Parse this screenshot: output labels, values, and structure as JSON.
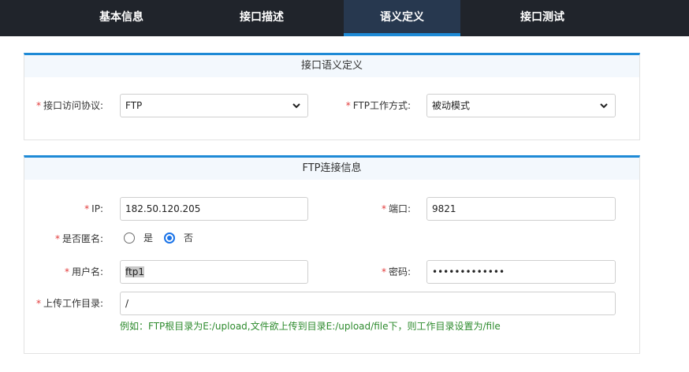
{
  "tabs": [
    {
      "label": "基本信息",
      "active": false
    },
    {
      "label": "接口描述",
      "active": false
    },
    {
      "label": "语义定义",
      "active": true
    },
    {
      "label": "接口测试",
      "active": false
    }
  ],
  "semantic_panel": {
    "title": "接口语义定义",
    "protocol": {
      "label": "接口访问协议:",
      "value": "FTP"
    },
    "ftp_mode": {
      "label": "FTP工作方式:",
      "value": "被动模式"
    }
  },
  "ftp_panel": {
    "title": "FTP连接信息",
    "ip": {
      "label": "IP:",
      "value": "182.50.120.205"
    },
    "port": {
      "label": "端口:",
      "value": "9821"
    },
    "anonymous": {
      "label": "是否匿名:",
      "yes_label": "是",
      "no_label": "否",
      "selected": "否"
    },
    "username": {
      "label": "用户名:",
      "value": "ftp1"
    },
    "password": {
      "label": "密码:",
      "value": "•••••••••••••"
    },
    "upload_dir": {
      "label": "上传工作目录:",
      "value": "/"
    },
    "hint": "例如：FTP根目录为E:/upload,文件欲上传到目录E:/upload/file下，则工作目录设置为/file"
  },
  "colors": {
    "accent": "#1e8ad6",
    "nav_bg": "#20242b",
    "required": "#e23b3b",
    "hint": "#2e8b2e"
  }
}
